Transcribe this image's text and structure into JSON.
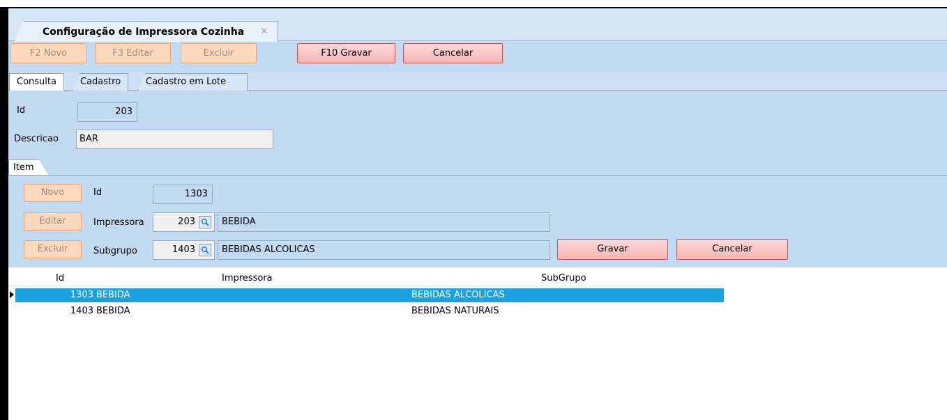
{
  "document_tab": {
    "title": "Configuração de Impressora Cozinha",
    "close_glyph": "✕"
  },
  "toolbar": {
    "novo": "F2 Novo",
    "editar": "F3 Editar",
    "excluir": "Excluir",
    "gravar": "F10 Gravar",
    "cancelar": "Cancelar"
  },
  "tabs": [
    "Consulta",
    "Cadastro",
    "Cadastro em Lote"
  ],
  "form": {
    "id_label": "Id",
    "id_value": "203",
    "descricao_label": "Descricao",
    "descricao_value": "BAR"
  },
  "item": {
    "tab_label": "Item",
    "buttons": {
      "novo": "Novo",
      "editar": "Editar",
      "excluir": "Excluir"
    },
    "id_label": "Id",
    "id_value": "1303",
    "impressora_label": "Impressora",
    "impressora_code": "203",
    "impressora_name": "BEBIDA",
    "subgrupo_label": "Subgrupo",
    "subgrupo_code": "1403",
    "subgrupo_name": "BEBIDAS ALCOLICAS",
    "gravar": "Gravar",
    "cancelar": "Cancelar"
  },
  "grid": {
    "columns": [
      "Id",
      "Impressora",
      "SubGrupo"
    ],
    "rows": [
      {
        "id": "1303",
        "impressora": "BEBIDA",
        "subgrupo": "BEBIDAS ALCOLICAS",
        "selected": true
      },
      {
        "id": "1403",
        "impressora": "BEBIDA",
        "subgrupo": "BEBIDAS NATURAIS",
        "selected": false
      }
    ]
  },
  "colors": {
    "panel_bg": "#c3daf3",
    "disabled_button_bg": "#fcd9bd",
    "active_button_bg": "#f6b4b4",
    "selection": "#1aa1e1"
  },
  "icons": {
    "lookup": "magnifier-icon",
    "row_indicator": "triangle-right-icon",
    "close": "close-icon"
  }
}
